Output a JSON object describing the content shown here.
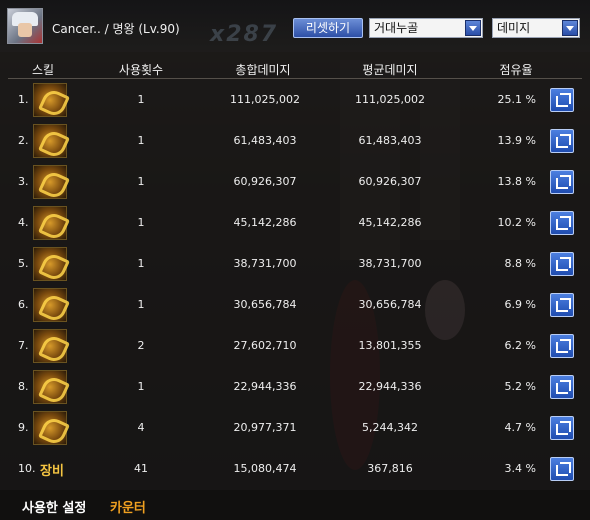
{
  "header": {
    "character_name": "Cancer.. / 명왕 (Lv.90)",
    "reset_label": "리셋하기",
    "type_select": "거대누골",
    "metric_select": "데미지"
  },
  "columns": [
    "스킬",
    "사용횟수",
    "총합데미지",
    "평균데미지",
    "점유율"
  ],
  "rows": [
    {
      "rank": "1.",
      "icon": "skill-icon",
      "count": "1",
      "total": "111,025,002",
      "avg": "111,025,002",
      "share": "25.1 %"
    },
    {
      "rank": "2.",
      "icon": "skill-icon",
      "count": "1",
      "total": "61,483,403",
      "avg": "61,483,403",
      "share": "13.9 %"
    },
    {
      "rank": "3.",
      "icon": "skill-icon",
      "count": "1",
      "total": "60,926,307",
      "avg": "60,926,307",
      "share": "13.8 %"
    },
    {
      "rank": "4.",
      "icon": "skill-icon",
      "count": "1",
      "total": "45,142,286",
      "avg": "45,142,286",
      "share": "10.2 %"
    },
    {
      "rank": "5.",
      "icon": "skill-icon",
      "count": "1",
      "total": "38,731,700",
      "avg": "38,731,700",
      "share": "8.8 %"
    },
    {
      "rank": "6.",
      "icon": "skill-icon",
      "count": "1",
      "total": "30,656,784",
      "avg": "30,656,784",
      "share": "6.9 %"
    },
    {
      "rank": "7.",
      "icon": "skill-icon",
      "count": "2",
      "total": "27,602,710",
      "avg": "13,801,355",
      "share": "6.2 %"
    },
    {
      "rank": "8.",
      "icon": "skill-icon",
      "count": "1",
      "total": "22,944,336",
      "avg": "22,944,336",
      "share": "5.2 %"
    },
    {
      "rank": "9.",
      "icon": "skill-icon",
      "count": "4",
      "total": "20,977,371",
      "avg": "5,244,342",
      "share": "4.7 %"
    },
    {
      "rank": "10.",
      "skill_text": "장비",
      "count": "41",
      "total": "15,080,474",
      "avg": "367,816",
      "share": "3.4 %"
    }
  ],
  "tabs": {
    "settings": "사용한 설정",
    "counter": "카운터"
  },
  "colors": {
    "accent_blue": "#2d4fa6",
    "tab_active": "#f0a020",
    "skill_text": "#f5c542"
  }
}
